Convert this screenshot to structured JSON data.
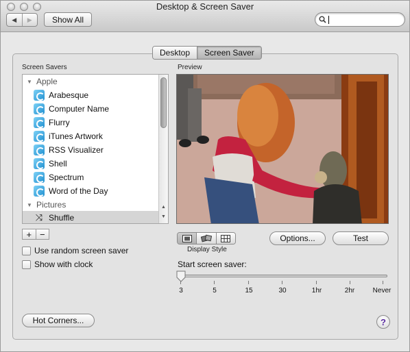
{
  "window": {
    "title": "Desktop & Screen Saver"
  },
  "toolbar": {
    "back_icon": "back-arrow",
    "forward_icon": "forward-arrow",
    "show_all_label": "Show All",
    "search": {
      "value": "",
      "placeholder": "",
      "icon": "magnifier"
    }
  },
  "tabs": [
    {
      "label": "Desktop",
      "selected": false
    },
    {
      "label": "Screen Saver",
      "selected": true
    }
  ],
  "screen_savers": {
    "label": "Screen Savers",
    "groups": [
      {
        "name": "Apple",
        "expanded": true,
        "items": [
          "Arabesque",
          "Computer Name",
          "Flurry",
          "iTunes Artwork",
          "RSS Visualizer",
          "Shell",
          "Spectrum",
          "Word of the Day"
        ]
      },
      {
        "name": "Pictures",
        "expanded": true,
        "items": [
          "Shuffle"
        ]
      }
    ],
    "selected_item": "Shuffle",
    "add_label": "+",
    "remove_label": "−"
  },
  "options": {
    "use_random_label": "Use random screen saver",
    "use_random_checked": false,
    "show_clock_label": "Show with clock",
    "show_clock_checked": false
  },
  "preview": {
    "label": "Preview",
    "display_style_label": "Display Style",
    "display_style_selected": "slideshow",
    "options_button": "Options...",
    "test_button": "Test"
  },
  "start_screen_saver": {
    "label": "Start screen saver:",
    "ticks": [
      "3",
      "5",
      "15",
      "30",
      "1hr",
      "2hr",
      "Never"
    ],
    "selected": "3"
  },
  "footer": {
    "hot_corners_label": "Hot Corners...",
    "help_label": "?"
  },
  "colors": {
    "window_bg": "#e8e8e8",
    "selection": "#d5d5d5",
    "help_accent": "#5a2ca0"
  }
}
